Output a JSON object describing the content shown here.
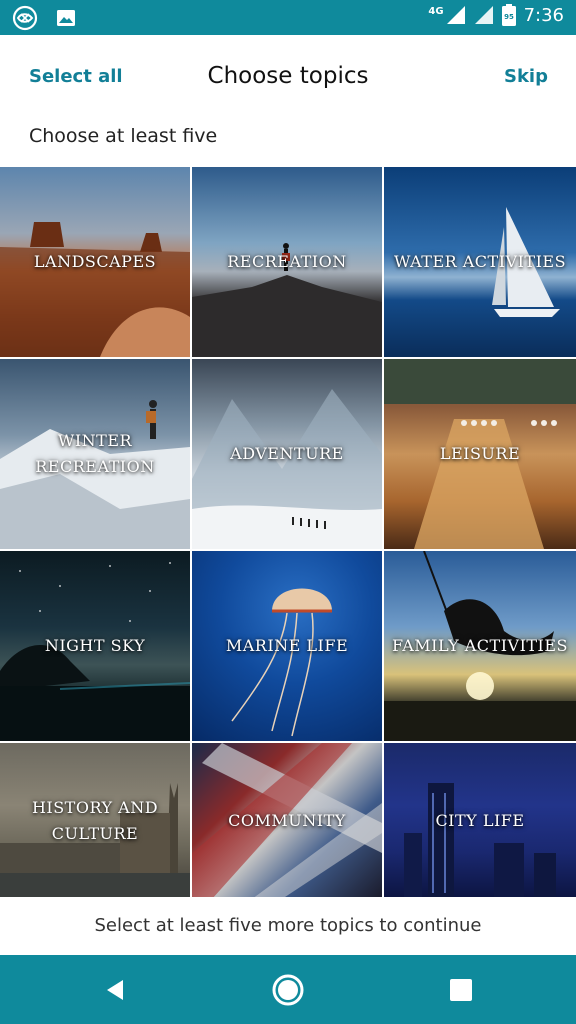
{
  "status_bar": {
    "time": "7:36",
    "network": "4G",
    "battery": "95",
    "icons": [
      "app-notification-icon",
      "image-notification-icon",
      "signal-icon",
      "battery-icon"
    ]
  },
  "header": {
    "select_all": "Select all",
    "title": "Choose topics",
    "skip": "Skip",
    "subtitle": "Choose at least five"
  },
  "topics": [
    {
      "label": "LANDSCAPES"
    },
    {
      "label": "RECREATION"
    },
    {
      "label": "WATER ACTIVITIES"
    },
    {
      "label": "WINTER\nRECREATION"
    },
    {
      "label": "ADVENTURE"
    },
    {
      "label": "LEISURE"
    },
    {
      "label": "NIGHT SKY"
    },
    {
      "label": "MARINE LIFE"
    },
    {
      "label": "FAMILY ACTIVITIES"
    },
    {
      "label": "HISTORY AND\nCULTURE"
    },
    {
      "label": "COMMUNITY"
    },
    {
      "label": "CITY LIFE"
    }
  ],
  "footer": {
    "hint": "Select at least five more topics to continue"
  },
  "colors": {
    "accent": "#0f8a9c",
    "link": "#127f97"
  }
}
